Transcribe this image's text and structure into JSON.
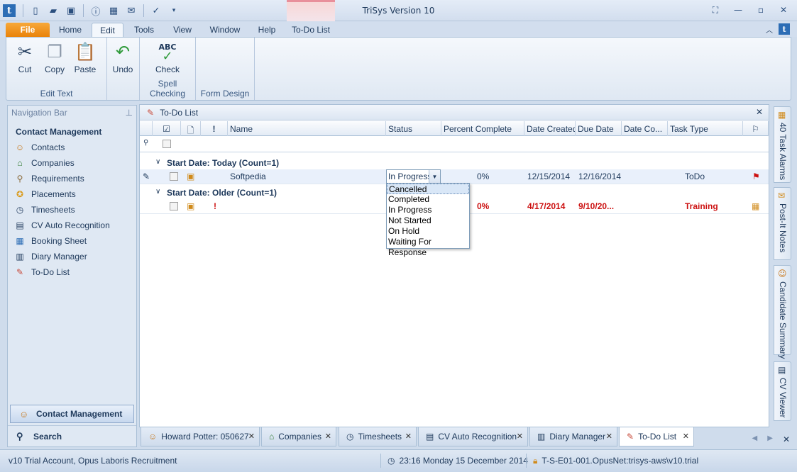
{
  "window": {
    "title": "TriSys Version 10"
  },
  "ribbon_tabs": [
    "File",
    "Home",
    "Edit",
    "Tools",
    "View",
    "Window",
    "Help",
    "To-Do List"
  ],
  "ribbon": {
    "groups": [
      {
        "label": "Edit Text",
        "buttons": [
          "Cut",
          "Copy",
          "Paste",
          "Undo"
        ]
      },
      {
        "label": "Spell Checking",
        "buttons": [
          "Check"
        ]
      },
      {
        "label": "Form Design",
        "buttons": []
      }
    ]
  },
  "nav": {
    "header": "Navigation Bar",
    "section": "Contact Management",
    "items": [
      {
        "label": "Contacts",
        "icon": "contacts-icon"
      },
      {
        "label": "Companies",
        "icon": "companies-icon"
      },
      {
        "label": "Requirements",
        "icon": "requirements-icon"
      },
      {
        "label": "Placements",
        "icon": "placements-icon"
      },
      {
        "label": "Timesheets",
        "icon": "clock-icon"
      },
      {
        "label": "CV Auto Recognition",
        "icon": "cv-icon"
      },
      {
        "label": "Booking Sheet",
        "icon": "booking-icon"
      },
      {
        "label": "Diary Manager",
        "icon": "diary-icon"
      },
      {
        "label": "To-Do List",
        "icon": "todo-icon"
      }
    ],
    "bottom": {
      "selected": "Contact Management",
      "search": "Search"
    }
  },
  "doc": {
    "title": "To-Do List",
    "columns": [
      "Name",
      "Status",
      "Percent Complete",
      "Date Created",
      "Due Date",
      "Date Co...",
      "Task Type"
    ],
    "groups": [
      {
        "label": "Start Date: Today (Count=1)",
        "rows": [
          {
            "name": "Softpedia",
            "status": "In Progress",
            "percent": "0%",
            "created": "12/15/2014",
            "due": "12/16/2014",
            "completed": "",
            "type": "ToDo"
          }
        ]
      },
      {
        "label": "Start Date: Older (Count=1)",
        "rows": [
          {
            "name": "",
            "status": "",
            "percent": "0%",
            "created": "4/17/2014",
            "due": "9/10/20...",
            "completed": "",
            "type": "Training"
          }
        ]
      }
    ],
    "status_options": [
      "Cancelled",
      "Completed",
      "In Progress",
      "Not Started",
      "On Hold",
      "Waiting For Response"
    ]
  },
  "side_tabs": [
    "40 Task Alarms",
    "Post-It Notes",
    "Candidate Summary",
    "CV Viewer"
  ],
  "doc_tabs": [
    "Howard Potter: 050627",
    "Companies",
    "Timesheets",
    "CV Auto Recognition",
    "Diary Manager",
    "To-Do List"
  ],
  "status_bar": {
    "account": "v10 Trial Account, Opus Laboris Recruitment",
    "datetime": "23:16  Monday 15 December 2014",
    "server": "T-S-E01-001.OpusNet:trisys-aws\\v10.trial"
  },
  "colors": {
    "accent": "#2c6db5",
    "file_tab": "#e9830a",
    "overdue_red": "#cc1111"
  }
}
